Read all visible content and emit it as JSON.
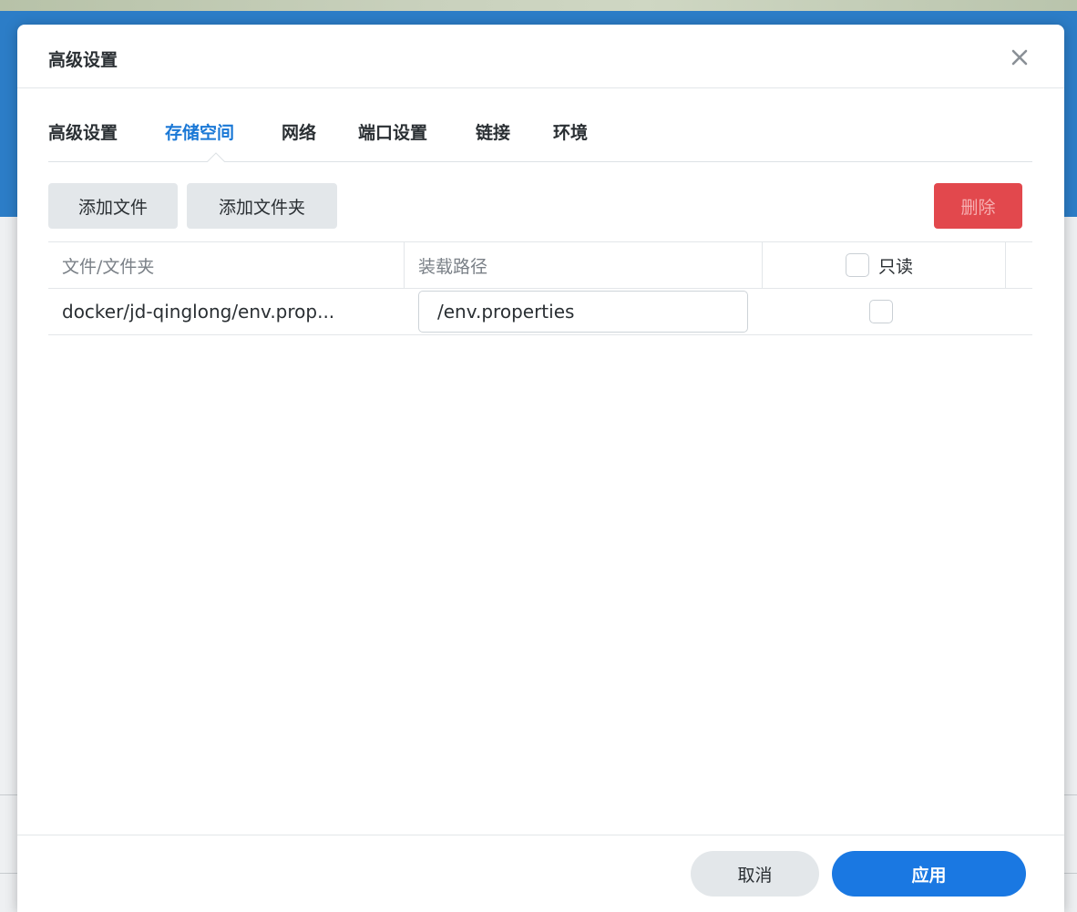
{
  "dialog": {
    "title": "高级设置"
  },
  "tabs": [
    {
      "label": "高级设置",
      "active": false
    },
    {
      "label": "存储空间",
      "active": true
    },
    {
      "label": "网络",
      "active": false
    },
    {
      "label": "端口设置",
      "active": false
    },
    {
      "label": "链接",
      "active": false
    },
    {
      "label": "环境",
      "active": false
    }
  ],
  "toolbar": {
    "add_file_label": "添加文件",
    "add_folder_label": "添加文件夹",
    "delete_label": "删除"
  },
  "table": {
    "headers": {
      "file_folder": "文件/文件夹",
      "mount_path": "装载路径",
      "readonly": "只读"
    },
    "rows": [
      {
        "path": "docker/jd-qinglong/env.prop...",
        "mount_path": "/env.properties",
        "readonly": false
      }
    ]
  },
  "footer": {
    "cancel_label": "取消",
    "apply_label": "应用"
  },
  "colors": {
    "accent": "#1a78e2",
    "active_tab": "#1a78d6",
    "danger": "#e0393e"
  }
}
